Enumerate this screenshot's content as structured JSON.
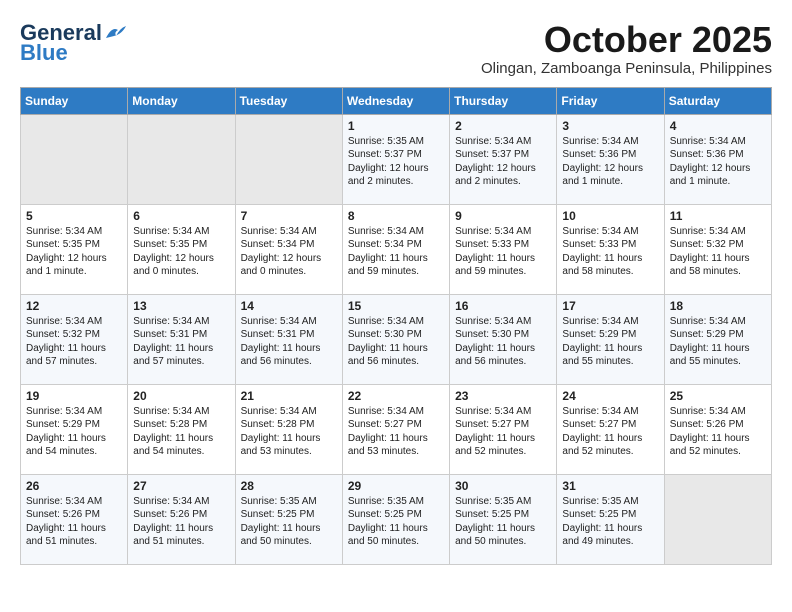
{
  "header": {
    "logo_general": "General",
    "logo_blue": "Blue",
    "month_year": "October 2025",
    "location": "Olingan, Zamboanga Peninsula, Philippines"
  },
  "weekdays": [
    "Sunday",
    "Monday",
    "Tuesday",
    "Wednesday",
    "Thursday",
    "Friday",
    "Saturday"
  ],
  "weeks": [
    [
      {
        "day": "",
        "content": ""
      },
      {
        "day": "",
        "content": ""
      },
      {
        "day": "",
        "content": ""
      },
      {
        "day": "1",
        "content": "Sunrise: 5:35 AM\nSunset: 5:37 PM\nDaylight: 12 hours\nand 2 minutes."
      },
      {
        "day": "2",
        "content": "Sunrise: 5:34 AM\nSunset: 5:37 PM\nDaylight: 12 hours\nand 2 minutes."
      },
      {
        "day": "3",
        "content": "Sunrise: 5:34 AM\nSunset: 5:36 PM\nDaylight: 12 hours\nand 1 minute."
      },
      {
        "day": "4",
        "content": "Sunrise: 5:34 AM\nSunset: 5:36 PM\nDaylight: 12 hours\nand 1 minute."
      }
    ],
    [
      {
        "day": "5",
        "content": "Sunrise: 5:34 AM\nSunset: 5:35 PM\nDaylight: 12 hours\nand 1 minute."
      },
      {
        "day": "6",
        "content": "Sunrise: 5:34 AM\nSunset: 5:35 PM\nDaylight: 12 hours\nand 0 minutes."
      },
      {
        "day": "7",
        "content": "Sunrise: 5:34 AM\nSunset: 5:34 PM\nDaylight: 12 hours\nand 0 minutes."
      },
      {
        "day": "8",
        "content": "Sunrise: 5:34 AM\nSunset: 5:34 PM\nDaylight: 11 hours\nand 59 minutes."
      },
      {
        "day": "9",
        "content": "Sunrise: 5:34 AM\nSunset: 5:33 PM\nDaylight: 11 hours\nand 59 minutes."
      },
      {
        "day": "10",
        "content": "Sunrise: 5:34 AM\nSunset: 5:33 PM\nDaylight: 11 hours\nand 58 minutes."
      },
      {
        "day": "11",
        "content": "Sunrise: 5:34 AM\nSunset: 5:32 PM\nDaylight: 11 hours\nand 58 minutes."
      }
    ],
    [
      {
        "day": "12",
        "content": "Sunrise: 5:34 AM\nSunset: 5:32 PM\nDaylight: 11 hours\nand 57 minutes."
      },
      {
        "day": "13",
        "content": "Sunrise: 5:34 AM\nSunset: 5:31 PM\nDaylight: 11 hours\nand 57 minutes."
      },
      {
        "day": "14",
        "content": "Sunrise: 5:34 AM\nSunset: 5:31 PM\nDaylight: 11 hours\nand 56 minutes."
      },
      {
        "day": "15",
        "content": "Sunrise: 5:34 AM\nSunset: 5:30 PM\nDaylight: 11 hours\nand 56 minutes."
      },
      {
        "day": "16",
        "content": "Sunrise: 5:34 AM\nSunset: 5:30 PM\nDaylight: 11 hours\nand 56 minutes."
      },
      {
        "day": "17",
        "content": "Sunrise: 5:34 AM\nSunset: 5:29 PM\nDaylight: 11 hours\nand 55 minutes."
      },
      {
        "day": "18",
        "content": "Sunrise: 5:34 AM\nSunset: 5:29 PM\nDaylight: 11 hours\nand 55 minutes."
      }
    ],
    [
      {
        "day": "19",
        "content": "Sunrise: 5:34 AM\nSunset: 5:29 PM\nDaylight: 11 hours\nand 54 minutes."
      },
      {
        "day": "20",
        "content": "Sunrise: 5:34 AM\nSunset: 5:28 PM\nDaylight: 11 hours\nand 54 minutes."
      },
      {
        "day": "21",
        "content": "Sunrise: 5:34 AM\nSunset: 5:28 PM\nDaylight: 11 hours\nand 53 minutes."
      },
      {
        "day": "22",
        "content": "Sunrise: 5:34 AM\nSunset: 5:27 PM\nDaylight: 11 hours\nand 53 minutes."
      },
      {
        "day": "23",
        "content": "Sunrise: 5:34 AM\nSunset: 5:27 PM\nDaylight: 11 hours\nand 52 minutes."
      },
      {
        "day": "24",
        "content": "Sunrise: 5:34 AM\nSunset: 5:27 PM\nDaylight: 11 hours\nand 52 minutes."
      },
      {
        "day": "25",
        "content": "Sunrise: 5:34 AM\nSunset: 5:26 PM\nDaylight: 11 hours\nand 52 minutes."
      }
    ],
    [
      {
        "day": "26",
        "content": "Sunrise: 5:34 AM\nSunset: 5:26 PM\nDaylight: 11 hours\nand 51 minutes."
      },
      {
        "day": "27",
        "content": "Sunrise: 5:34 AM\nSunset: 5:26 PM\nDaylight: 11 hours\nand 51 minutes."
      },
      {
        "day": "28",
        "content": "Sunrise: 5:35 AM\nSunset: 5:25 PM\nDaylight: 11 hours\nand 50 minutes."
      },
      {
        "day": "29",
        "content": "Sunrise: 5:35 AM\nSunset: 5:25 PM\nDaylight: 11 hours\nand 50 minutes."
      },
      {
        "day": "30",
        "content": "Sunrise: 5:35 AM\nSunset: 5:25 PM\nDaylight: 11 hours\nand 50 minutes."
      },
      {
        "day": "31",
        "content": "Sunrise: 5:35 AM\nSunset: 5:25 PM\nDaylight: 11 hours\nand 49 minutes."
      },
      {
        "day": "",
        "content": ""
      }
    ]
  ]
}
